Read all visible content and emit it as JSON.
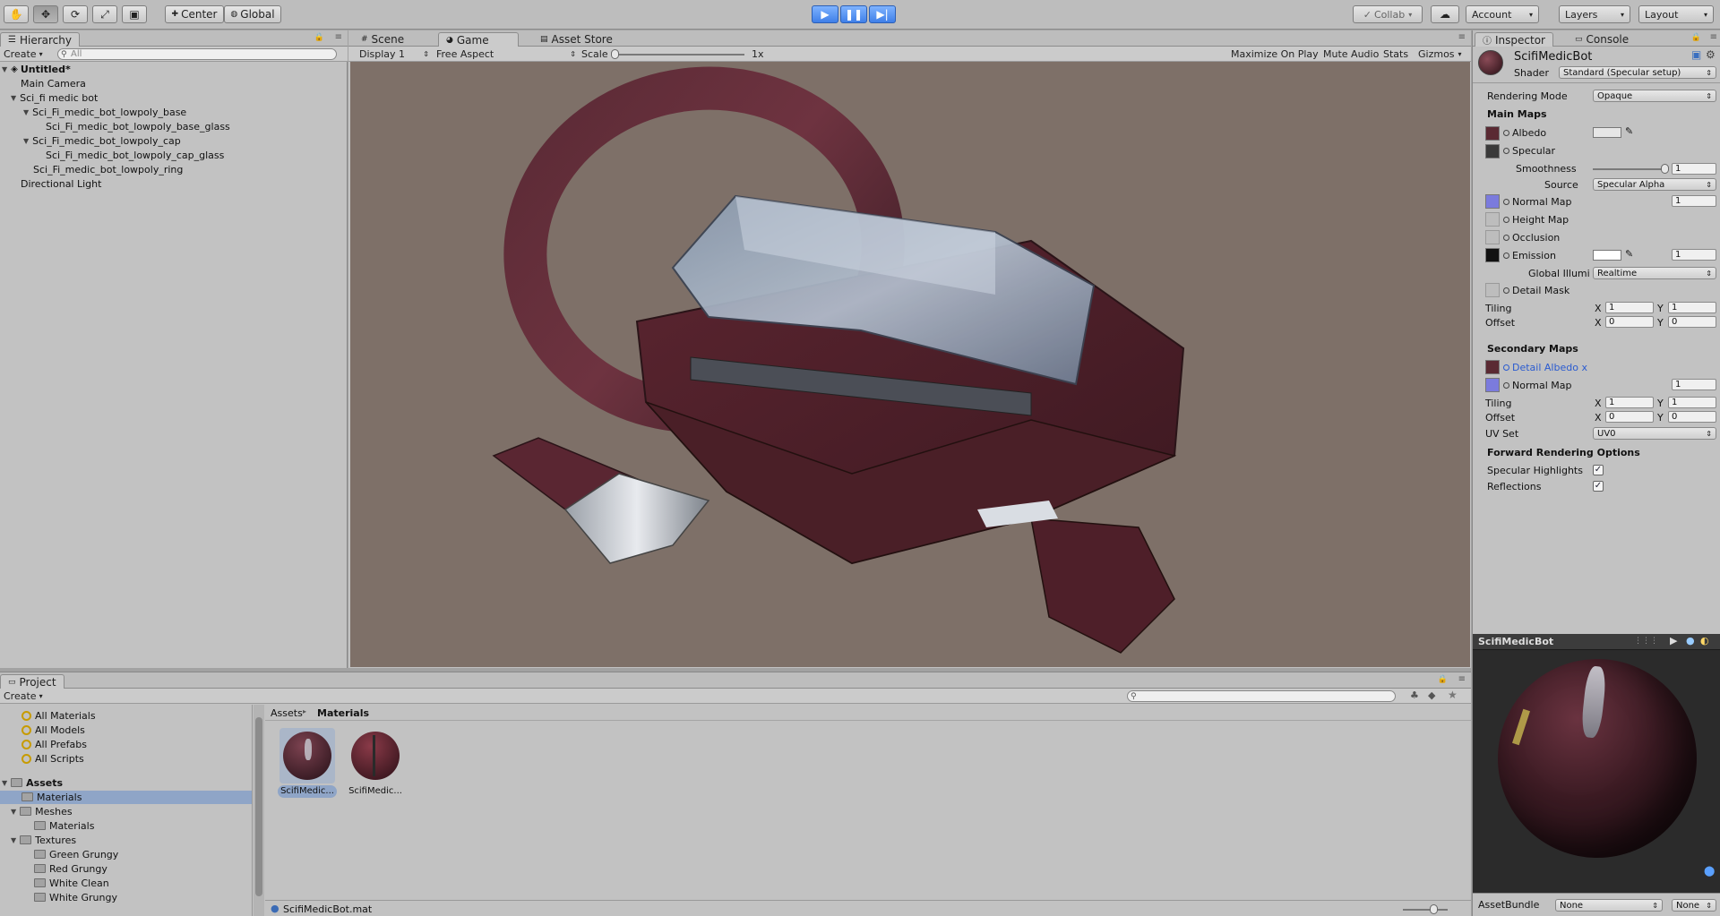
{
  "toolbar": {
    "tools": [
      "hand-tool-icon",
      "move-tool-icon",
      "rotate-tool-icon",
      "scale-tool-icon",
      "rect-tool-icon"
    ],
    "pivot_label": "Center",
    "space_label": "Global",
    "collab_label": "Collab",
    "account_label": "Account",
    "layers_label": "Layers",
    "layout_label": "Layout"
  },
  "hierarchy": {
    "tab_label": "Hierarchy",
    "create_label": "Create",
    "search_placeholder": "All",
    "scene_name": "Untitled*",
    "items": [
      {
        "label": "Main Camera"
      },
      {
        "label": "Sci_fi medic bot"
      },
      {
        "label": "Sci_Fi_medic_bot_lowpoly_base"
      },
      {
        "label": "Sci_Fi_medic_bot_lowpoly_base_glass"
      },
      {
        "label": "Sci_Fi_medic_bot_lowpoly_cap"
      },
      {
        "label": "Sci_Fi_medic_bot_lowpoly_cap_glass"
      },
      {
        "label": "Sci_Fi_medic_bot_lowpoly_ring"
      },
      {
        "label": "Directional Light"
      }
    ]
  },
  "center": {
    "tabs": [
      {
        "label": "Scene"
      },
      {
        "label": "Game"
      },
      {
        "label": "Asset Store"
      }
    ],
    "display_label": "Display 1",
    "aspect_label": "Free Aspect",
    "scale_label": "Scale",
    "scale_value": "1x",
    "maximize_label": "Maximize On Play",
    "mute_label": "Mute Audio",
    "stats_label": "Stats",
    "gizmos_label": "Gizmos"
  },
  "inspector": {
    "tab_label": "Inspector",
    "console_label": "Console",
    "material_name": "ScifiMedicBot",
    "shader_label": "Shader",
    "shader_value": "Standard (Specular setup)",
    "rendering_mode_label": "Rendering Mode",
    "rendering_mode_value": "Opaque",
    "main_maps_label": "Main Maps",
    "albedo_label": "Albedo",
    "specular_label": "Specular",
    "smoothness_label": "Smoothness",
    "smoothness_value": "1",
    "source_label": "Source",
    "source_value": "Specular Alpha",
    "normal_map_label": "Normal Map",
    "normal_map_value": "1",
    "height_map_label": "Height Map",
    "occlusion_label": "Occlusion",
    "emission_label": "Emission",
    "emission_value": "1",
    "global_illum_label": "Global Illumi",
    "global_illum_value": "Realtime",
    "detail_mask_label": "Detail Mask",
    "tiling_label": "Tiling",
    "offset_label": "Offset",
    "x_label": "X",
    "y_label": "Y",
    "tiling_x": "1",
    "tiling_y": "1",
    "offset_x": "0",
    "offset_y": "0",
    "secondary_maps_label": "Secondary Maps",
    "detail_albedo_label": "Detail Albedo x",
    "normal_map2_label": "Normal Map",
    "normal_map2_value": "1",
    "tiling2_x": "1",
    "tiling2_y": "1",
    "offset2_x": "0",
    "offset2_y": "0",
    "uv_set_label": "UV Set",
    "uv_set_value": "UV0",
    "forward_label": "Forward Rendering Options",
    "spec_highlights_label": "Specular Highlights",
    "reflections_label": "Reflections",
    "check_mark": "✓",
    "preview_title": "ScifiMedicBot",
    "assetbundle_label": "AssetBundle",
    "assetbundle_value": "None",
    "assetbundle_variant": "None"
  },
  "project": {
    "tab_label": "Project",
    "create_label": "Create",
    "favorites": [
      {
        "label": "All Materials"
      },
      {
        "label": "All Models"
      },
      {
        "label": "All Prefabs"
      },
      {
        "label": "All Scripts"
      }
    ],
    "assets_label": "Assets",
    "tree": [
      {
        "label": "Materials"
      },
      {
        "label": "Meshes"
      },
      {
        "label": "Materials"
      },
      {
        "label": "Textures"
      },
      {
        "label": "Green Grungy"
      },
      {
        "label": "Red Grungy"
      },
      {
        "label": "White Clean"
      },
      {
        "label": "White Grungy"
      }
    ],
    "breadcrumb_root": "Assets",
    "breadcrumb_sep": "▸",
    "breadcrumb_current": "Materials",
    "items": [
      {
        "label": "ScifiMedic..."
      },
      {
        "label": "ScifiMedic..."
      }
    ],
    "status_file": "ScifiMedicBot.mat"
  },
  "colors": {
    "accent_blue": "#3f7fe8",
    "selection": "#8fa5c7",
    "viewport_bg": "#7e7068"
  }
}
